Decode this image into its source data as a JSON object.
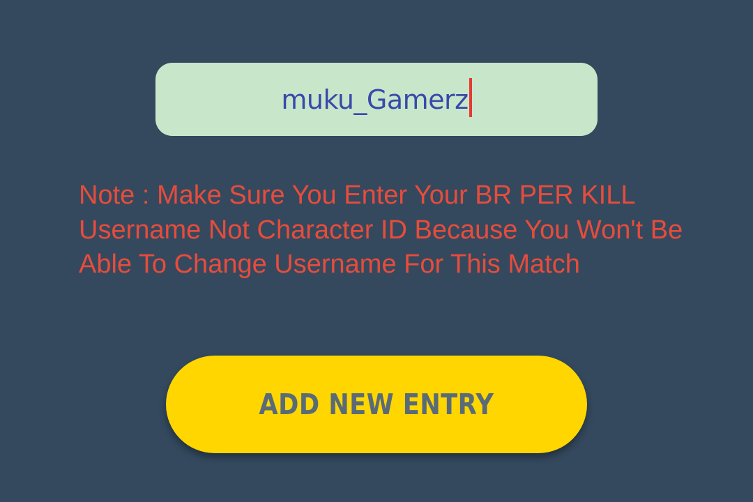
{
  "username_field": {
    "value": "muku_Gamerz"
  },
  "note": {
    "text": "Note : Make Sure You Enter Your BR PER KILL Username Not Character ID Because You Won't Be Able To Change Username For This Match"
  },
  "add_entry_button": {
    "label": "ADD NEW ENTRY"
  },
  "colors": {
    "background": "#34495e",
    "field_background": "#c8e6c9",
    "field_text": "#3949ab",
    "caret": "#e53935",
    "note_text": "#e74c3c",
    "button_background": "#ffd600",
    "button_text": "#5a6b78"
  }
}
